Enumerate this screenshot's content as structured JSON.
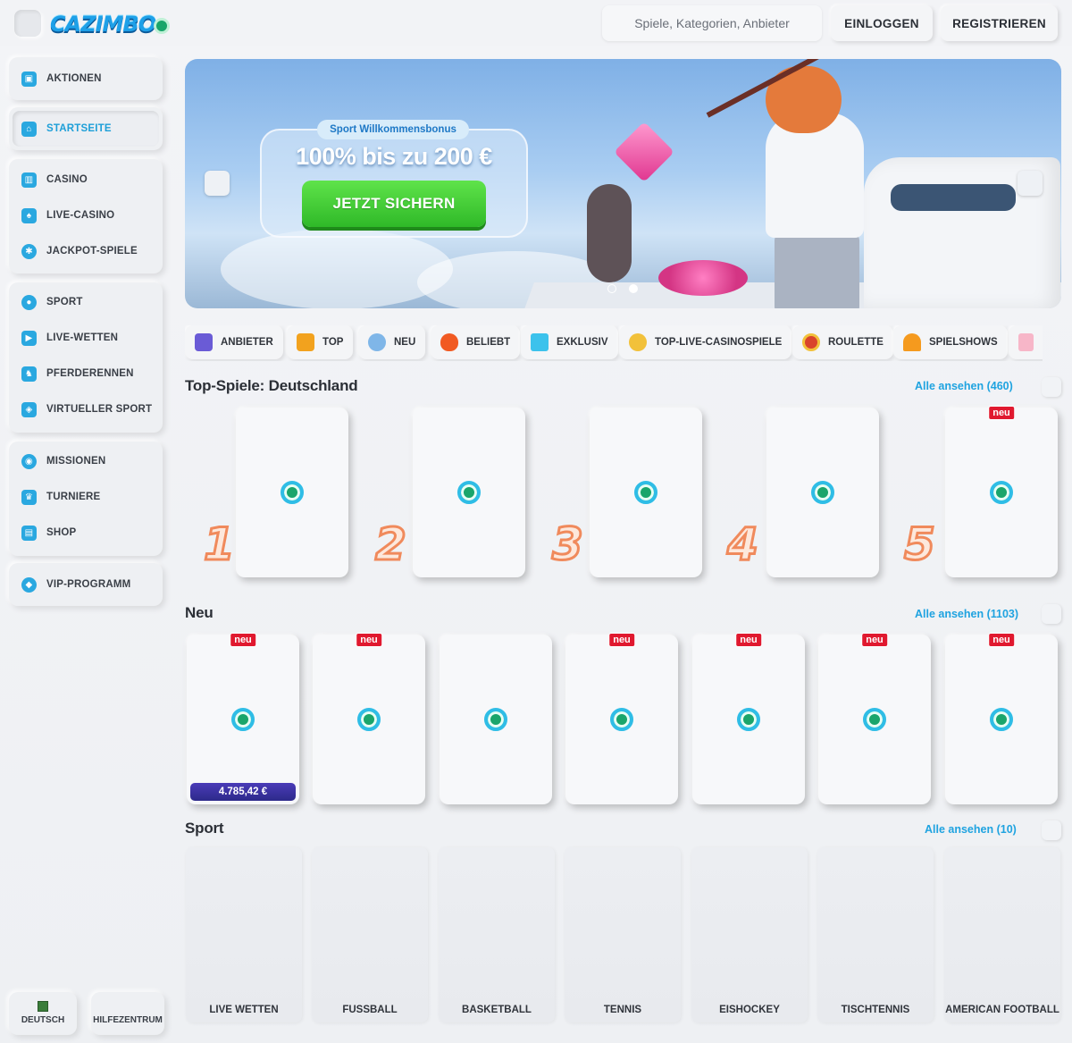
{
  "header": {
    "logo_text": "CAZIMBO",
    "search_placeholder": "Spiele, Kategorien, Anbieter",
    "login_label": "EINLOGGEN",
    "register_label": "REGISTRIEREN"
  },
  "sidebar": {
    "promotions": "AKTIONEN",
    "home": "STARTSEITE",
    "casino": [
      "CASINO",
      "LIVE-CASINO",
      "JACKPOT-SPIELE"
    ],
    "sport": [
      "SPORT",
      "LIVE-WETTEN",
      "PFERDERENNEN",
      "VIRTUELLER SPORT"
    ],
    "extras": [
      "MISSIONEN",
      "TURNIERE",
      "SHOP"
    ],
    "vip": "VIP-PROGRAMM",
    "language": "DEUTSCH",
    "help": "HILFEZENTRUM"
  },
  "banner": {
    "pill": "Sport Willkommensbonus",
    "title": "100% bis zu 200 €",
    "cta": "JETZT SICHERN"
  },
  "categories": [
    "ANBIETER",
    "TOP",
    "NEU",
    "BELIEBT",
    "EXKLUSIV",
    "TOP-LIVE-CASINOSPIELE",
    "ROULETTE",
    "SPIELSHOWS"
  ],
  "top_games": {
    "title": "Top-Spiele: Deutschland",
    "see_all": "Alle ansehen (460)",
    "ranks": [
      "1",
      "2",
      "3",
      "4",
      "5"
    ],
    "new_badge": "neu"
  },
  "new_games": {
    "title": "Neu",
    "see_all": "Alle ansehen (1103)",
    "new_badge": "neu",
    "jackpot": "4.785,42 €"
  },
  "sport": {
    "title": "Sport",
    "see_all": "Alle ansehen (10)",
    "items": [
      "LIVE WETTEN",
      "FUSSBALL",
      "BASKETBALL",
      "TENNIS",
      "EISHOCKEY",
      "TISCHTENNIS",
      "AMERICAN FOOTBALL"
    ]
  },
  "colors": {
    "accent": "#1fa3e0",
    "cta_green": "#2fb928",
    "new_badge": "#e0192f",
    "rank_orange": "#f08a5c"
  }
}
